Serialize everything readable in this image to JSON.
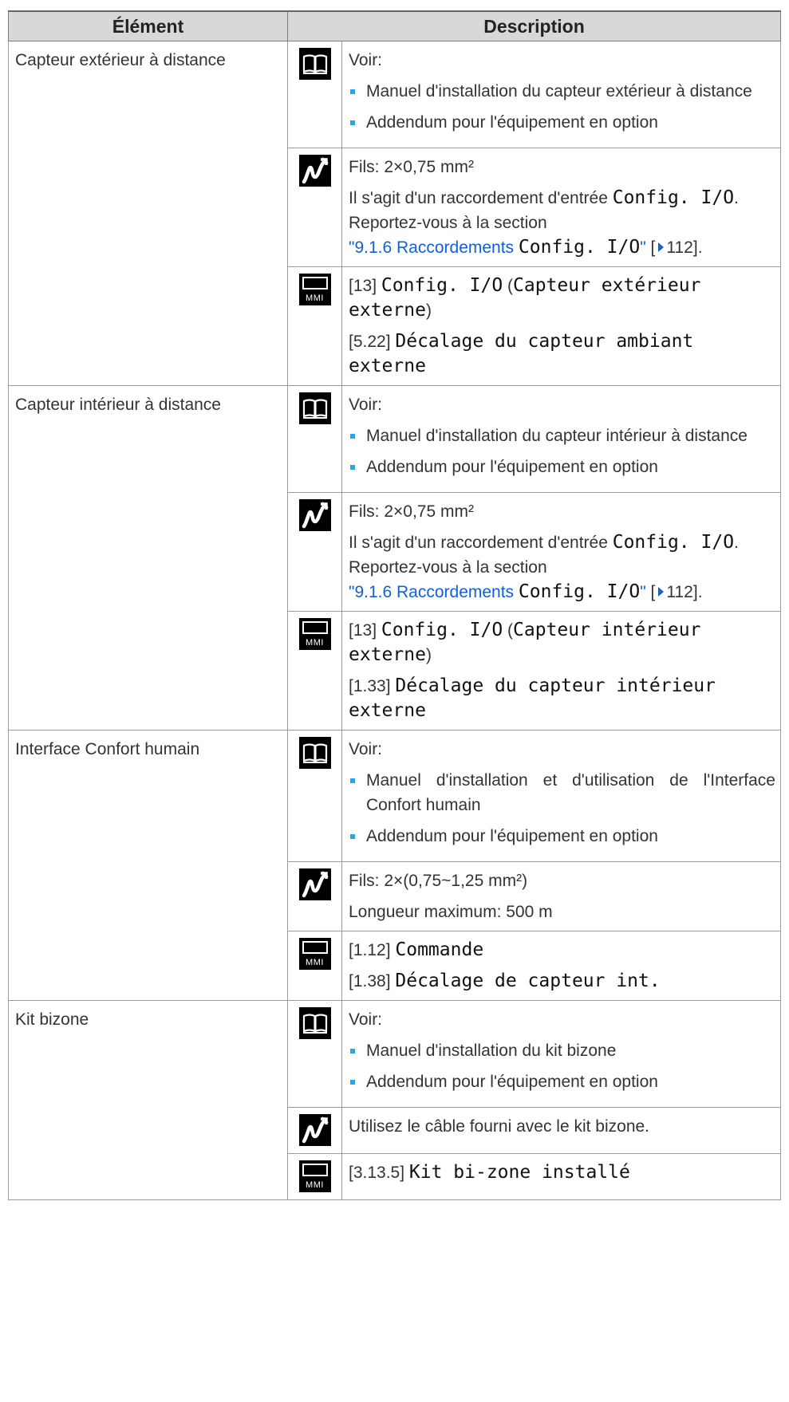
{
  "table": {
    "header": {
      "col_element": "Élément",
      "col_description": "Description"
    },
    "icon_names": {
      "manual": "book-icon",
      "wiring": "wire-icon",
      "interface": "mmi-icon"
    },
    "mmi_label": "MMI",
    "colors": {
      "bullet": "#2aa7df",
      "link": "#1060d8",
      "header_bg": "#d8d8d8"
    },
    "rows": [
      {
        "element": "Capteur extérieur à distance",
        "manual": {
          "intro": "Voir:",
          "bullets": [
            "Manuel d'installation du capteur extérieur à distance",
            "Addendum pour l'équipement en option"
          ]
        },
        "wiring": {
          "wires": "Fils: 2×0,75 mm²",
          "text_before": "Il s'agit d'un raccordement d'entrée ",
          "code": "Config. I/O",
          "text_after": ". Reportez-vous à la section ",
          "link_prefix": "\"9.1.6 Raccordements ",
          "link_code": "Config. I/O",
          "link_suffix": "\"",
          "page_open": " [",
          "page": "112",
          "page_close": "]."
        },
        "interface": {
          "line1_ref": "[13]",
          "line1_code": "Config. I/O",
          "line1_paren_open": " (",
          "line1_value": "Capteur extérieur externe",
          "line1_paren_close": ")",
          "line2_ref": "[5.22]",
          "line2_code": "Décalage du capteur ambiant externe"
        }
      },
      {
        "element": "Capteur intérieur à distance",
        "manual": {
          "intro": "Voir:",
          "bullets": [
            "Manuel d'installation du capteur intérieur à distance",
            "Addendum pour l'équipement en option"
          ]
        },
        "wiring": {
          "wires": "Fils: 2×0,75 mm²",
          "text_before": "Il s'agit d'un raccordement d'entrée ",
          "code": "Config. I/O",
          "text_after": ". Reportez-vous à la section ",
          "link_prefix": "\"9.1.6 Raccordements ",
          "link_code": "Config. I/O",
          "link_suffix": "\"",
          "page_open": " [",
          "page": "112",
          "page_close": "]."
        },
        "interface": {
          "line1_ref": "[13]",
          "line1_code": "Config. I/O",
          "line1_paren_open": " (",
          "line1_value": "Capteur intérieur externe",
          "line1_paren_close": ")",
          "line2_ref": "[1.33]",
          "line2_code": "Décalage du capteur intérieur externe"
        }
      },
      {
        "element": "Interface Confort humain",
        "manual": {
          "intro": "Voir:",
          "bullets": [
            "Manuel d'installation et d'utilisation de l'Interface Confort humain",
            "Addendum pour l'équipement en option"
          ]
        },
        "wiring": {
          "wires": "Fils: 2×(0,75~1,25 mm²)",
          "max_length": "Longueur maximum: 500 m"
        },
        "interface": {
          "line1_ref": "[1.12]",
          "line1_code": "Commande",
          "line2_ref": "[1.38]",
          "line2_code": "Décalage de capteur int."
        }
      },
      {
        "element": "Kit bizone",
        "manual": {
          "intro": "Voir:",
          "bullets": [
            "Manuel d'installation du kit bizone",
            "Addendum pour l'équipement en option"
          ]
        },
        "wiring": {
          "note": "Utilisez le câble fourni avec le kit bizone."
        },
        "interface": {
          "line1_ref": "[3.13.5]",
          "line1_code": "Kit bi-zone installé"
        }
      }
    ]
  }
}
